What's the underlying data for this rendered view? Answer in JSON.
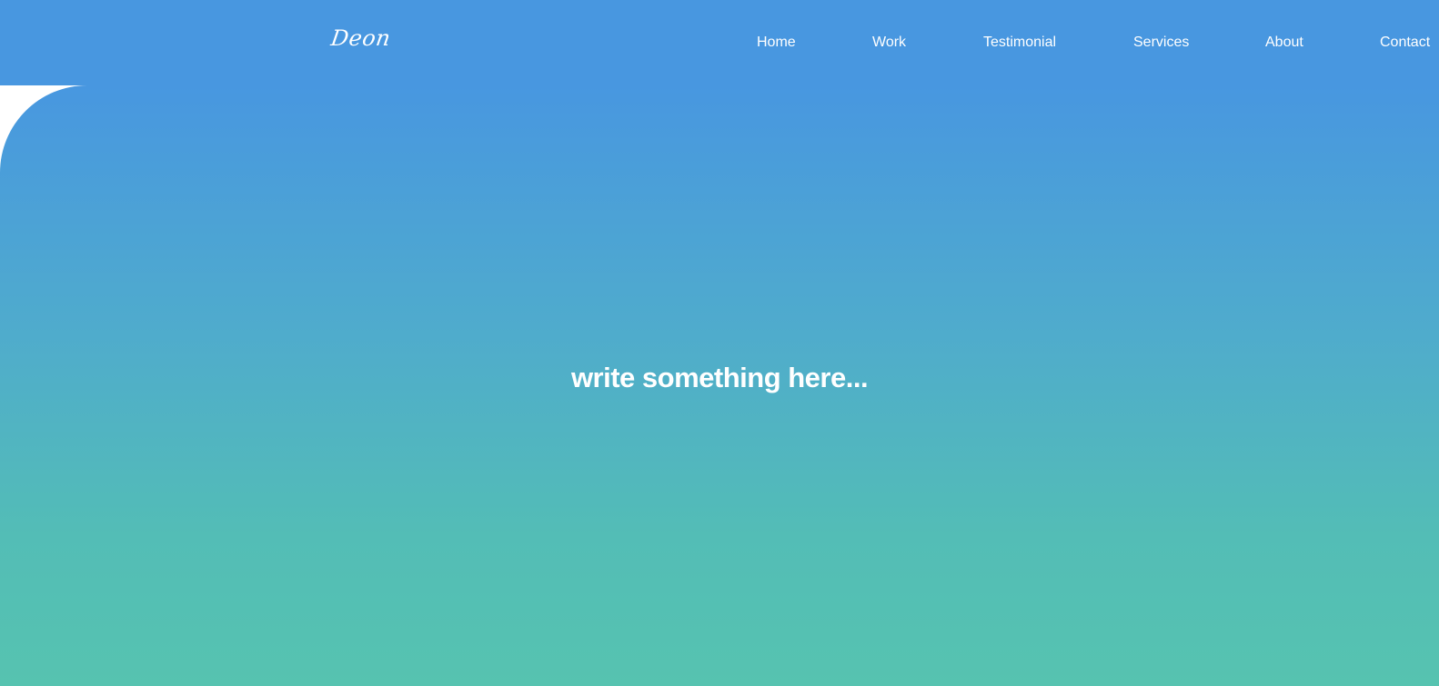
{
  "brand": {
    "logo_text": "Deon"
  },
  "nav": {
    "items": [
      {
        "label": "Home"
      },
      {
        "label": "Work"
      },
      {
        "label": "Testimonial"
      },
      {
        "label": "Services"
      },
      {
        "label": "About"
      },
      {
        "label": "Contact"
      }
    ]
  },
  "hero": {
    "title": "write something here..."
  },
  "colors": {
    "header_bg": "#4897e0",
    "gradient_top": "#4897e0",
    "gradient_bottom": "#56c3b0",
    "text": "#ffffff"
  }
}
